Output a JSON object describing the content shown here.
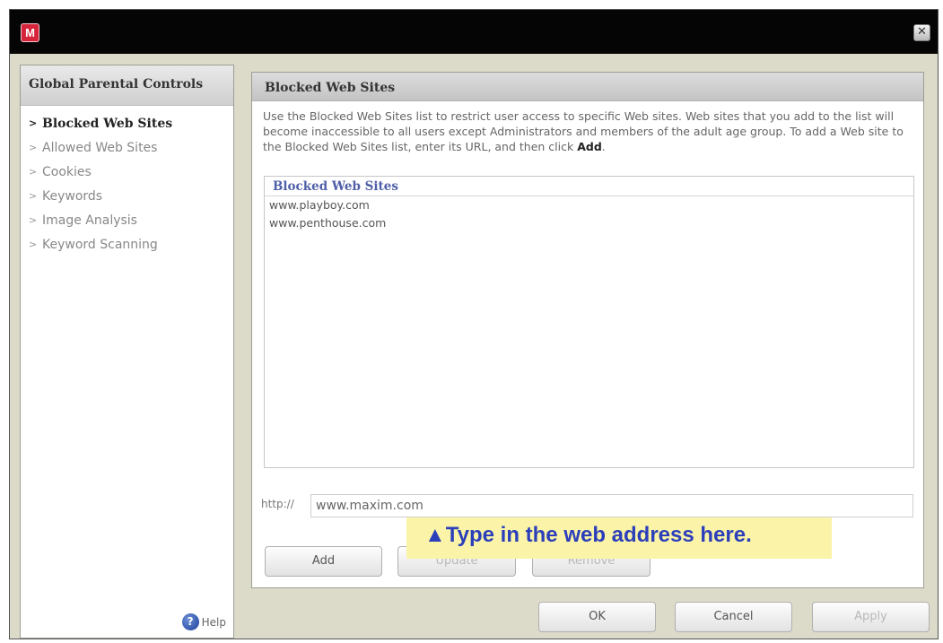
{
  "app": {
    "logo_letter": "M",
    "close_glyph": "✕"
  },
  "sidebar": {
    "title": "Global Parental Controls",
    "items": [
      {
        "label": "Blocked Web Sites",
        "active": true
      },
      {
        "label": "Allowed Web Sites",
        "active": false
      },
      {
        "label": "Cookies",
        "active": false
      },
      {
        "label": "Keywords",
        "active": false
      },
      {
        "label": "Image Analysis",
        "active": false
      },
      {
        "label": "Keyword Scanning",
        "active": false
      }
    ],
    "help_label": "Help"
  },
  "panel": {
    "title": "Blocked Web Sites",
    "description_prefix": "Use the Blocked Web Sites list to restrict user access to specific Web sites. Web sites that you add to the list will become inaccessible to all users except Administrators and members of the adult age group. To add a Web site to the Blocked Web Sites list, enter its URL, and then click ",
    "description_action": "Add",
    "description_suffix": ".",
    "list_header": "Blocked Web Sites",
    "sites": [
      "www.playboy.com",
      "www.penthouse.com"
    ],
    "url_prefix": "http://",
    "url_value": "www.maxim.com",
    "tip": "▲Type in the web address here.",
    "buttons": {
      "add": "Add",
      "update": "Update",
      "remove": "Remove"
    }
  },
  "footer": {
    "ok": "OK",
    "cancel": "Cancel",
    "apply": "Apply"
  },
  "colors": {
    "titlebar": "#050505",
    "logo": "#d6243a",
    "tip_bg": "#fbf4a8",
    "tip_text": "#2c3fba"
  }
}
